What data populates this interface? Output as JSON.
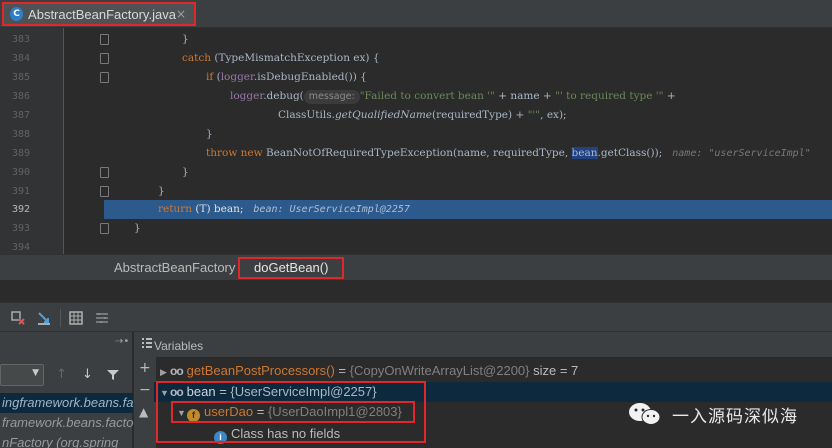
{
  "tab": {
    "icon": "java-class-icon",
    "icon_letter": "C",
    "filename": "AbstractBeanFactory.java",
    "close": "×"
  },
  "editor": {
    "lines": [
      {
        "n": "383"
      },
      {
        "n": "384"
      },
      {
        "n": "385"
      },
      {
        "n": "386"
      },
      {
        "n": "387"
      },
      {
        "n": "388"
      },
      {
        "n": "389"
      },
      {
        "n": "390"
      },
      {
        "n": "391"
      },
      {
        "n": "392"
      },
      {
        "n": "393"
      },
      {
        "n": "394"
      }
    ],
    "l383": "}",
    "l384_kw": "catch",
    "l384_rest": " (TypeMismatchException ex) {",
    "l385_kw": "if",
    "l385_a": " (",
    "l385_fld": "logger",
    "l385_b": ".isDebugEnabled()) {",
    "l386_fld": "logger",
    "l386_a": ".debug(",
    "l386_hint": "message:",
    "l386_str1": "\"Failed to convert bean '\"",
    "l386_b": " + name + ",
    "l386_str2": "\"' to required type '\"",
    "l386_c": " +",
    "l387_a": "ClassUtils.",
    "l387_ital": "getQualifiedName",
    "l387_b": "(requiredType) + ",
    "l387_str": "\"'\"",
    "l387_c": ", ex);",
    "l388": "}",
    "l389_kw1": "throw",
    "l389_kw2": " new",
    "l389_a": " BeanNotOfRequiredTypeException(name, requiredType, ",
    "l389_sel": "bean",
    "l389_b": ".getClass());",
    "l389_hint": "name: \"userServiceImpl\"",
    "l390": "}",
    "l391": "}",
    "l392_kw": "return",
    "l392_a": " (",
    "l392_t": "T",
    "l392_b": ") bean;",
    "l392_hint": "bean: UserServiceImpl@2257",
    "l393": "}"
  },
  "breadcrumb": {
    "class": "AbstractBeanFactory",
    "method": "doGetBean()"
  },
  "frames": {
    "pin": "⇢•",
    "items": [
      "ingframework.beans.fa",
      "framework.beans.facto",
      "nFactory (org.spring"
    ]
  },
  "variables": {
    "title": "Variables",
    "rows": [
      {
        "name": "getBeanPostProcessors()",
        "eq": " = ",
        "value": "{CopyOnWriteArrayList@2200}",
        "extra": "  size = 7"
      },
      {
        "name": "bean",
        "eq": " = ",
        "value": "{UserServiceImpl@2257}"
      },
      {
        "name": "userDao",
        "eq": " = ",
        "value": "{UserDaoImpl1@2803}"
      },
      {
        "info": "Class has no fields"
      }
    ]
  },
  "watermark": {
    "text": "一入源码深似海",
    "icon": "wechat-icon"
  },
  "colors": {
    "highlight_red": "#e0282b",
    "exec_line": "#2d5a8c",
    "keyword": "#cc7832",
    "string": "#6a8759"
  }
}
